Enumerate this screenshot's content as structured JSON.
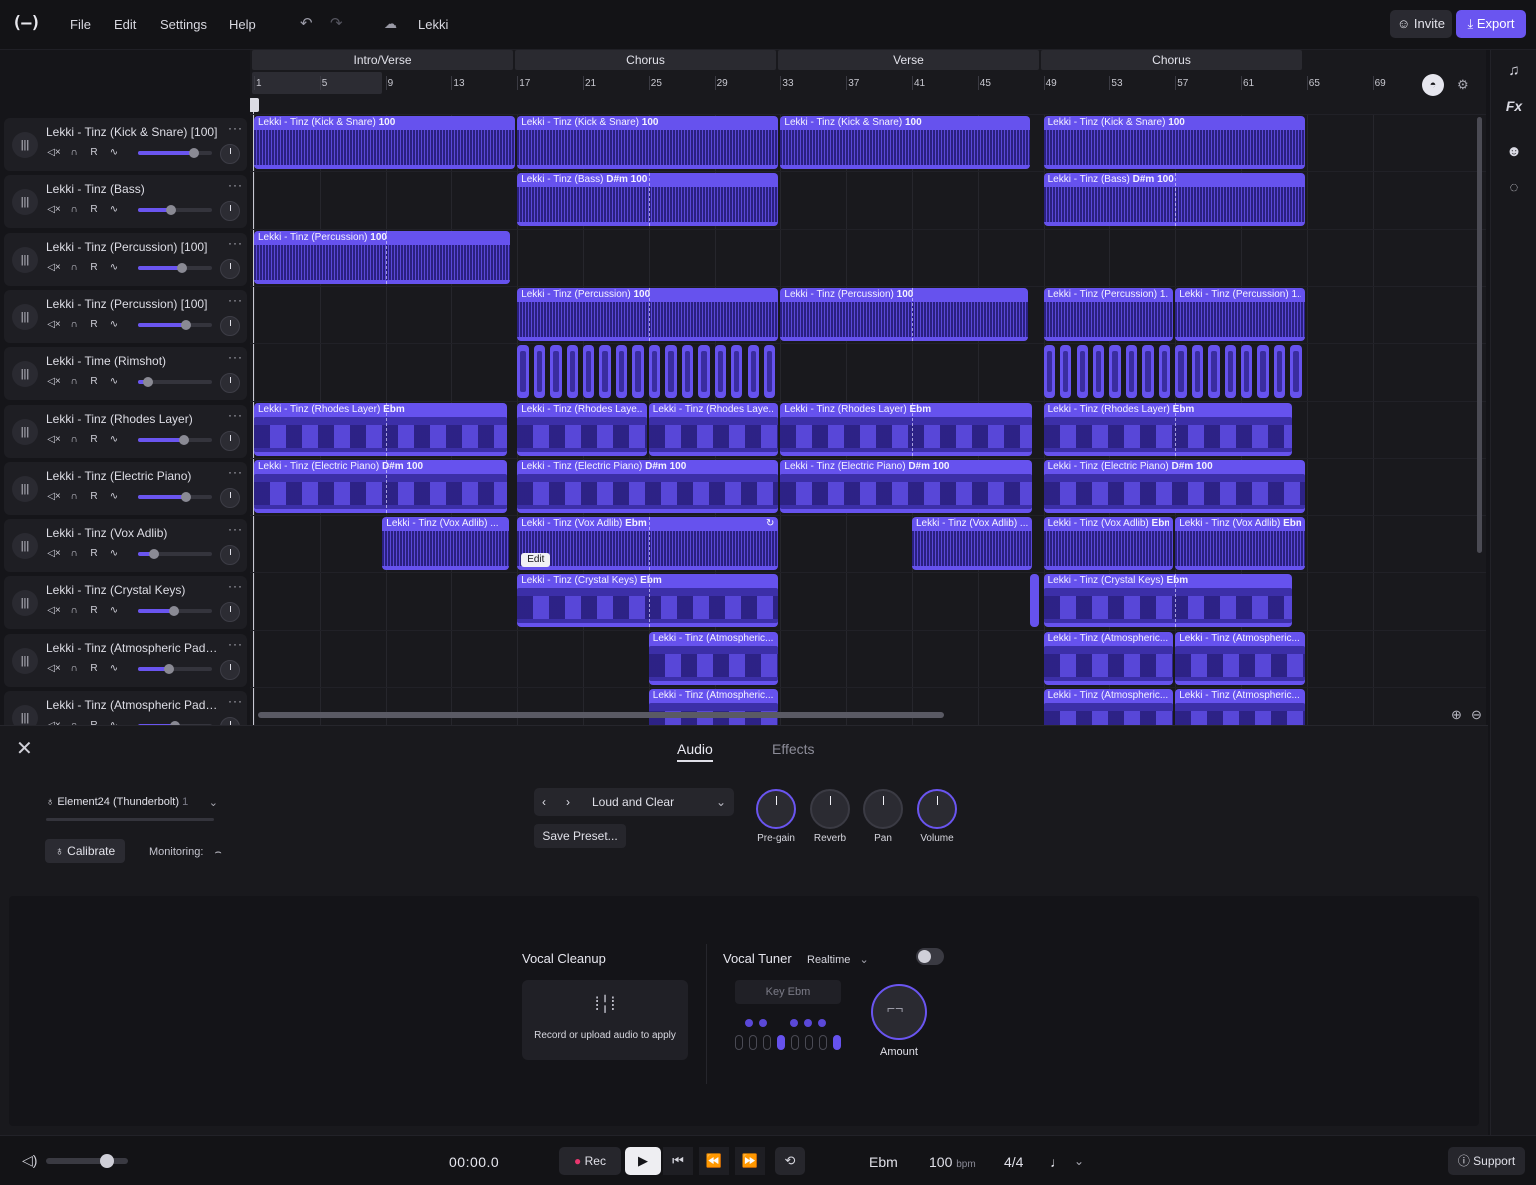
{
  "app": {
    "project_name": "Lekki"
  },
  "menu": {
    "items": [
      "File",
      "Edit",
      "Settings",
      "Help"
    ]
  },
  "toolbar": {
    "invite_label": "Invite",
    "export_label": "Export"
  },
  "sections": [
    "Intro/Verse",
    "Chorus",
    "Verse",
    "Chorus"
  ],
  "bars": [
    "1",
    "5",
    "9",
    "13",
    "17",
    "21",
    "25",
    "29",
    "33",
    "37",
    "41",
    "45",
    "49",
    "53",
    "57",
    "61",
    "65",
    "69"
  ],
  "tracks": [
    {
      "name": "Lekki - Tinz (Kick & Snare) [100]",
      "volume": 0.75
    },
    {
      "name": "Lekki - Tinz (Bass)",
      "volume": 0.45
    },
    {
      "name": "Lekki - Tinz (Percussion) [100]",
      "volume": 0.6
    },
    {
      "name": "Lekki - Tinz (Percussion) [100]",
      "volume": 0.65
    },
    {
      "name": "Lekki - Time (Rimshot)",
      "volume": 0.13
    },
    {
      "name": "Lekki - Tinz (Rhodes Layer)",
      "volume": 0.62
    },
    {
      "name": "Lekki - Tinz (Electric Piano)",
      "volume": 0.65
    },
    {
      "name": "Lekki - Tinz (Vox Adlib)",
      "volume": 0.22
    },
    {
      "name": "Lekki - Tinz (Crystal Keys)",
      "volume": 0.48
    },
    {
      "name": "Lekki - Tinz (Atmospheric Pad 0...",
      "volume": 0.42
    },
    {
      "name": "Lekki - Tinz (Atmospheric Pad 0...",
      "volume": 0.5
    }
  ],
  "track_controls": {
    "record_label": "R"
  },
  "clips": {
    "kick": {
      "title": "Lekki - Tinz (Kick & Snare)",
      "tag": "100"
    },
    "bass": {
      "title": "Lekki - Tinz (Bass)",
      "tag": "D#m 100"
    },
    "perc": {
      "title": "Lekki - Tinz (Percussion)",
      "tag": "100"
    },
    "perc_short": "Lekki - Tinz (Percussion) 1...",
    "rhodes": {
      "title": "Lekki - Tinz (Rhodes Layer)",
      "tag": "Ebm"
    },
    "rhodes_short": "Lekki - Tinz (Rhodes Laye...",
    "ep": {
      "title": "Lekki - Tinz (Electric Piano)",
      "tag": "D#m 100"
    },
    "vox": {
      "title": "Lekki - Tinz (Vox Adlib)",
      "tag": "Ebm"
    },
    "vox_short": "Lekki - Tinz (Vox Adlib) ...",
    "keys": {
      "title": "Lekki - Tinz (Crystal Keys)",
      "tag": "Ebm"
    },
    "atmos_short": "Lekki - Tinz (Atmospheric...",
    "edit_label": "Edit"
  },
  "panel": {
    "tabs": [
      "Audio",
      "Effects"
    ],
    "input_device": "Element24 (Thunderbolt)",
    "input_channel": "1",
    "calibrate_label": "Calibrate",
    "monitoring_label": "Monitoring:",
    "preset_name": "Loud and Clear",
    "save_preset_label": "Save Preset...",
    "knobs": [
      "Pre-gain",
      "Reverb",
      "Pan",
      "Volume"
    ]
  },
  "effects": {
    "vocal_cleanup_title": "Vocal Cleanup",
    "vocal_cleanup_hint": "Record or upload audio to apply",
    "vocal_tuner_title": "Vocal Tuner",
    "vocal_tuner_mode": "Realtime",
    "key_label": "Key Ebm",
    "amount_label": "Amount"
  },
  "transport": {
    "time": "00:00.0",
    "rec_label": "Rec",
    "key": "Ebm",
    "tempo": "100",
    "tempo_unit": "bpm",
    "time_signature": "4/4",
    "support_label": "Support"
  },
  "colors": {
    "accent": "#6a55f0",
    "clip": "#6652ee",
    "rec": "#e8366e"
  }
}
